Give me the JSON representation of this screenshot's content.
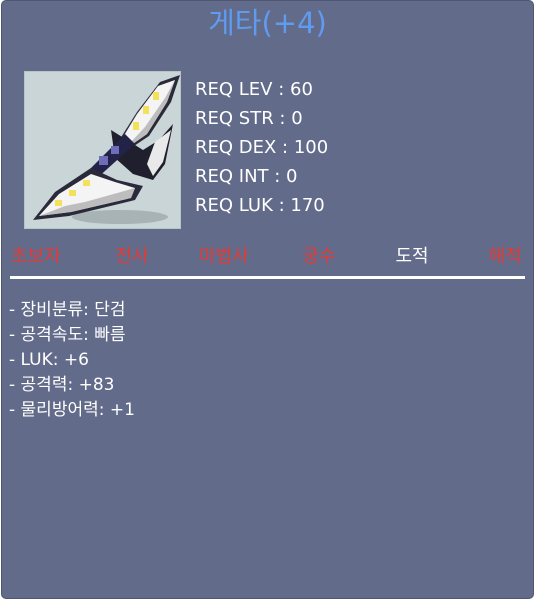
{
  "item": {
    "name": "게타(+4)"
  },
  "image_name": "dagger-icon",
  "requirements": [
    "REQ LEV : 60",
    "REQ STR : 0",
    "REQ DEX : 100",
    "REQ INT : 0",
    "REQ LUK : 170"
  ],
  "jobs": [
    {
      "label": "초보자",
      "usable": false
    },
    {
      "label": "전사",
      "usable": false
    },
    {
      "label": "마법사",
      "usable": false
    },
    {
      "label": "궁수",
      "usable": false
    },
    {
      "label": "도적",
      "usable": true
    },
    {
      "label": "해적",
      "usable": false
    }
  ],
  "stats": [
    "- 장비분류: 단검",
    "- 공격속도: 빠름",
    "- LUK: +6",
    "- 공격력: +83",
    "- 물리방어력: +1"
  ],
  "colors": {
    "background": "#626b89",
    "title": "#5f9bf0",
    "job_disabled": "#e53935",
    "job_enabled": "#ffffff"
  }
}
